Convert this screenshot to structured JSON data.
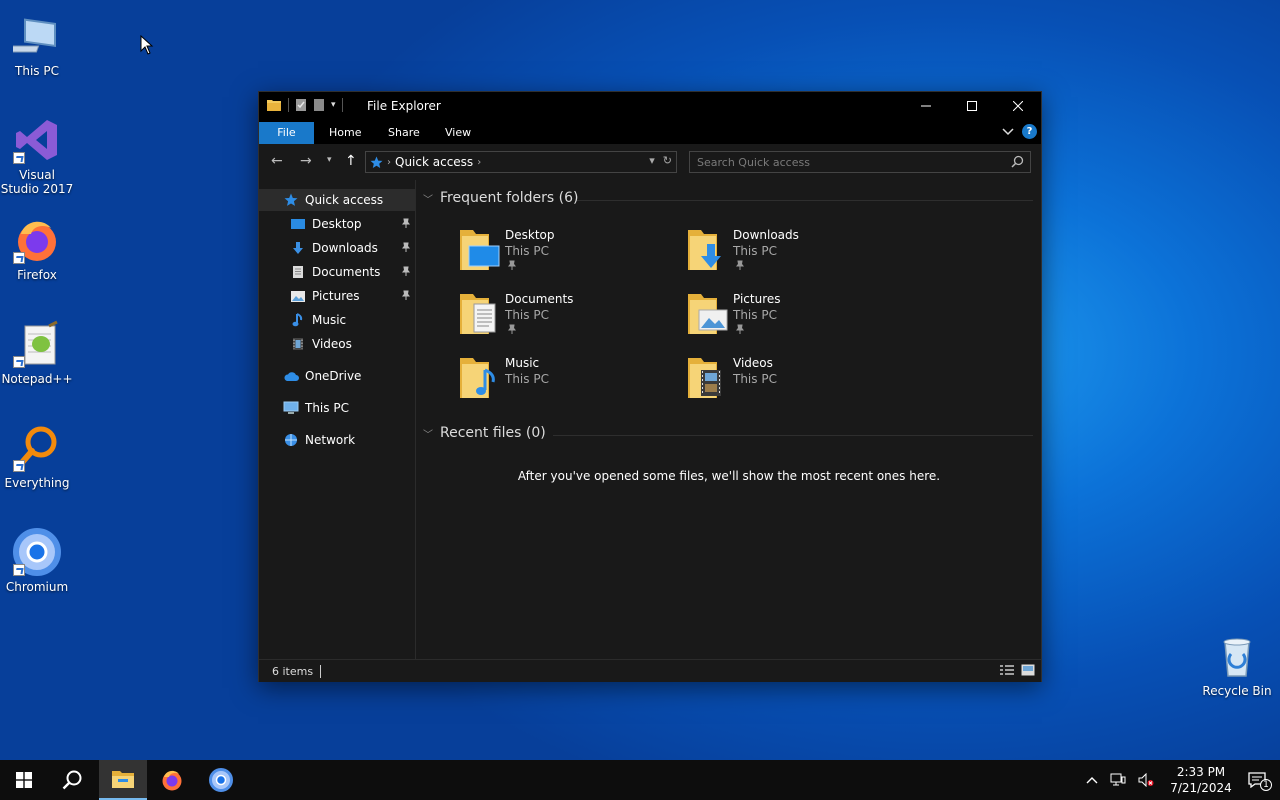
{
  "desktop": {
    "icons": [
      {
        "label": "This PC"
      },
      {
        "label": "Visual Studio 2017"
      },
      {
        "label": "Firefox"
      },
      {
        "label": "Notepad++"
      },
      {
        "label": "Everything"
      },
      {
        "label": "Chromium"
      },
      {
        "label": "Recycle Bin"
      }
    ]
  },
  "window": {
    "title": "File Explorer",
    "ribbon_tabs": [
      "File",
      "Home",
      "Share",
      "View"
    ],
    "address": {
      "location": "Quick access"
    },
    "search": {
      "placeholder": "Search Quick access"
    },
    "nav": [
      {
        "label": "Quick access",
        "icon": "star-icon"
      },
      {
        "label": "Desktop",
        "icon": "desktop-folder-icon",
        "pinned": true
      },
      {
        "label": "Downloads",
        "icon": "download-arrow-icon",
        "pinned": true
      },
      {
        "label": "Documents",
        "icon": "document-icon",
        "pinned": true
      },
      {
        "label": "Pictures",
        "icon": "picture-icon",
        "pinned": true
      },
      {
        "label": "Music",
        "icon": "music-note-icon"
      },
      {
        "label": "Videos",
        "icon": "film-icon"
      },
      {
        "label": "OneDrive",
        "icon": "cloud-icon"
      },
      {
        "label": "This PC",
        "icon": "computer-icon"
      },
      {
        "label": "Network",
        "icon": "network-icon"
      }
    ],
    "frequent": {
      "heading": "Frequent folders (6)",
      "folders": [
        {
          "name": "Desktop",
          "location": "This PC",
          "pinned": true
        },
        {
          "name": "Downloads",
          "location": "This PC",
          "pinned": true
        },
        {
          "name": "Documents",
          "location": "This PC",
          "pinned": true
        },
        {
          "name": "Pictures",
          "location": "This PC",
          "pinned": true
        },
        {
          "name": "Music",
          "location": "This PC"
        },
        {
          "name": "Videos",
          "location": "This PC"
        }
      ]
    },
    "recent": {
      "heading": "Recent files (0)",
      "empty_message": "After you've opened some files, we'll show the most recent ones here."
    },
    "status": {
      "items": "6 items"
    }
  },
  "taskbar": {
    "clock_time": "2:33 PM",
    "clock_date": "7/21/2024",
    "notification_count": "1"
  },
  "colors": {
    "accent": "#1979ca",
    "folder": "#f3c95c",
    "window_bg": "#191919",
    "titlebar_bg": "#000000"
  }
}
